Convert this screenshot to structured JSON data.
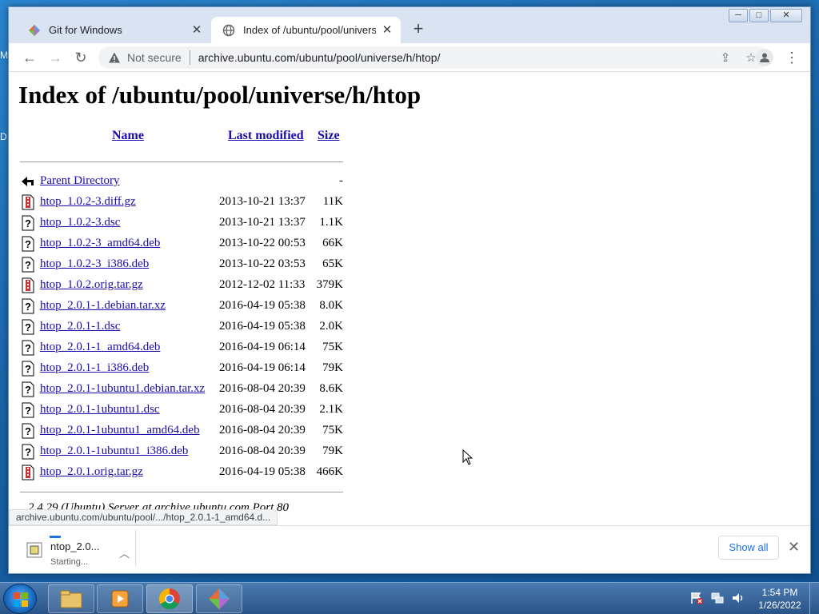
{
  "desktop": {
    "left_letters": [
      "M",
      "D"
    ]
  },
  "browser": {
    "tabs": [
      {
        "title": "Git for Windows",
        "icon": "git-for-windows-icon",
        "active": false
      },
      {
        "title": "Index of /ubuntu/pool/universe/h",
        "icon": "globe-icon",
        "active": true
      }
    ],
    "window_controls": {
      "minimize": "─",
      "maximize": "□",
      "close": "✕"
    },
    "toolbar": {
      "back": "←",
      "forward": "→",
      "reload": "↻",
      "security_label": "Not secure",
      "url": "archive.ubuntu.com/ubuntu/pool/universe/h/htop/",
      "menu": "⋮"
    },
    "accent": "#1a73e8"
  },
  "page": {
    "title": "Index of /ubuntu/pool/universe/h/htop",
    "columns": {
      "name": "Name",
      "modified": "Last modified",
      "size": "Size"
    },
    "parent": {
      "name": "Parent Directory",
      "size": "-"
    },
    "files": [
      {
        "name": "htop_1.0.2-3.diff.gz",
        "modified": "2013-10-21 13:37",
        "size": "11K",
        "icon": "compressed-file-icon"
      },
      {
        "name": "htop_1.0.2-3.dsc",
        "modified": "2013-10-21 13:37",
        "size": "1.1K",
        "icon": "unknown-file-icon"
      },
      {
        "name": "htop_1.0.2-3_amd64.deb",
        "modified": "2013-10-22 00:53",
        "size": "66K",
        "icon": "unknown-file-icon"
      },
      {
        "name": "htop_1.0.2-3_i386.deb",
        "modified": "2013-10-22 03:53",
        "size": "65K",
        "icon": "unknown-file-icon"
      },
      {
        "name": "htop_1.0.2.orig.tar.gz",
        "modified": "2012-12-02 11:33",
        "size": "379K",
        "icon": "compressed-file-icon"
      },
      {
        "name": "htop_2.0.1-1.debian.tar.xz",
        "modified": "2016-04-19 05:38",
        "size": "8.0K",
        "icon": "unknown-file-icon"
      },
      {
        "name": "htop_2.0.1-1.dsc",
        "modified": "2016-04-19 05:38",
        "size": "2.0K",
        "icon": "unknown-file-icon"
      },
      {
        "name": "htop_2.0.1-1_amd64.deb",
        "modified": "2016-04-19 06:14",
        "size": "75K",
        "icon": "unknown-file-icon"
      },
      {
        "name": "htop_2.0.1-1_i386.deb",
        "modified": "2016-04-19 06:14",
        "size": "79K",
        "icon": "unknown-file-icon"
      },
      {
        "name": "htop_2.0.1-1ubuntu1.debian.tar.xz",
        "modified": "2016-08-04 20:39",
        "size": "8.6K",
        "icon": "unknown-file-icon"
      },
      {
        "name": "htop_2.0.1-1ubuntu1.dsc",
        "modified": "2016-08-04 20:39",
        "size": "2.1K",
        "icon": "unknown-file-icon"
      },
      {
        "name": "htop_2.0.1-1ubuntu1_amd64.deb",
        "modified": "2016-08-04 20:39",
        "size": "75K",
        "icon": "unknown-file-icon"
      },
      {
        "name": "htop_2.0.1-1ubuntu1_i386.deb",
        "modified": "2016-08-04 20:39",
        "size": "79K",
        "icon": "unknown-file-icon"
      },
      {
        "name": "htop_2.0.1.orig.tar.gz",
        "modified": "2016-04-19 05:38",
        "size": "466K",
        "icon": "compressed-file-icon"
      }
    ],
    "footer": "2.4.29 (Ubuntu) Server at archive.ubuntu.com Port 80"
  },
  "status_bubble": "archive.ubuntu.com/ubuntu/pool/.../htop_2.0.1-1_amd64.d...",
  "downloads": {
    "item_name": "ntop_2.0...",
    "item_status": "Starting...",
    "show_all": "Show all",
    "close": "✕"
  },
  "taskbar": {
    "apps": [
      "file-explorer-icon",
      "media-player-icon",
      "chrome-icon",
      "git-for-windows-icon"
    ],
    "time": "1:54 PM",
    "date": "1/26/2022"
  }
}
